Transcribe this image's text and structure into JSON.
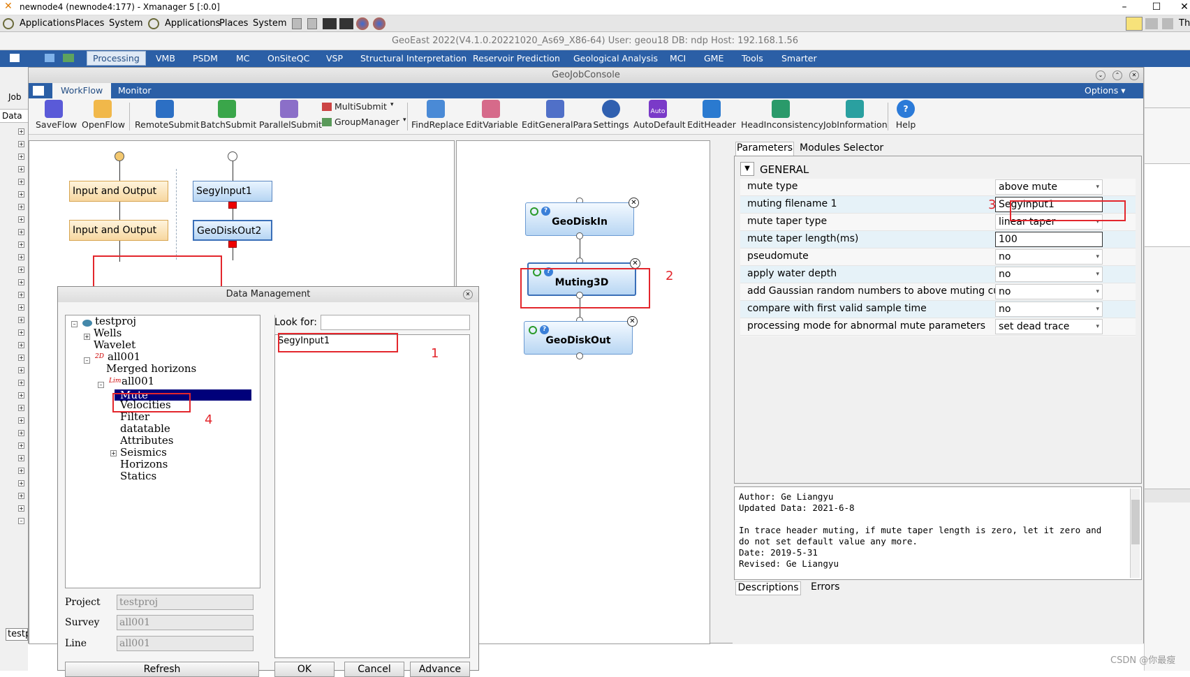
{
  "window": {
    "title": "newnode4 (newnode4:177) - Xmanager 5 [:0.0]"
  },
  "gnome": {
    "items": [
      "Applications",
      "Places",
      "System",
      "Applications",
      "Places",
      "System"
    ],
    "tray_right": "Th"
  },
  "system_info": "GeoEast 2022(V4.1.0.20221020_As69_X86-64)   User: geou18    DB: ndp    Host: 192.168.1.56",
  "menu": {
    "items": [
      "Processing",
      "VMB",
      "PSDM",
      "MC",
      "OnSiteQC",
      "VSP",
      "Structural Interpretation",
      "Reservoir Prediction",
      "Geological Analysis",
      "MCI",
      "GME",
      "Tools",
      "Smarter"
    ],
    "active": "Processing"
  },
  "side": {
    "job_label": "Job",
    "data_label": "Data"
  },
  "console": {
    "title": "GeoJobConsole",
    "tabs": [
      "WorkFlow",
      "Monitor"
    ],
    "options_label": "Options",
    "toolbar": [
      "SaveFlow",
      "OpenFlow",
      "RemoteSubmit",
      "BatchSubmit",
      "ParallelSubmit",
      "MultiSubmit",
      "GroupManager",
      "FindReplace",
      "EditVariable",
      "EditGeneralPara",
      "Settings",
      "AutoDefault",
      "EditHeader",
      "HeadInconsistency",
      "JobInformation",
      "Help"
    ],
    "auto_badge": "Auto"
  },
  "flow_left": {
    "nodes": [
      "Input and Output",
      "Input and Output",
      "SegyInput1",
      "GeoDiskOut2"
    ]
  },
  "flow_mid": {
    "nodes": [
      "GeoDiskIn",
      "Muting3D",
      "GeoDiskOut"
    ]
  },
  "params": {
    "tabs": [
      "Parameters",
      "Modules Selector"
    ],
    "section": "GENERAL",
    "rows": [
      {
        "label": "mute type",
        "value": "above mute"
      },
      {
        "label": "muting filename 1",
        "value": "SegyInput1"
      },
      {
        "label": "mute taper type",
        "value": "linear taper"
      },
      {
        "label": "mute taper length(ms)",
        "value": "100"
      },
      {
        "label": "pseudomute",
        "value": "no"
      },
      {
        "label": "apply water depth",
        "value": "no"
      },
      {
        "label": "add Gaussian random numbers to above muting curve",
        "value": "no"
      },
      {
        "label": "compare with first valid sample time",
        "value": "no"
      },
      {
        "label": "processing mode for abnormal mute parameters",
        "value": "set dead trace"
      }
    ],
    "description": "Author: Ge Liangyu\nUpdated Data: 2021-6-8\n\nIn trace header muting, if mute taper length is zero, let it zero and\ndo not set default value any more.\nDate: 2019-5-31\nRevised: Ge Liangyu",
    "bottom_tabs": [
      "Descriptions",
      "Errors"
    ]
  },
  "data_mgmt": {
    "title": "Data Management",
    "tree": [
      "testproj",
      "Wells",
      "Wavelet",
      "all001",
      "Merged horizons",
      "all001",
      "Mute",
      "Velocities",
      "Filter",
      "datatable",
      "Attributes",
      "Seismics",
      "Horizons",
      "Statics"
    ],
    "line_tag": "2D",
    "lim_tag": "Lim",
    "look_for_label": "Look for:",
    "look_for_value": "",
    "result": "SegyInput1",
    "project_label": "Project",
    "project_value": "testproj",
    "survey_label": "Survey",
    "survey_value": "all001",
    "line_label": "Line",
    "line_value": "all001",
    "buttons": [
      "Refresh",
      "OK",
      "Cancel",
      "Advance"
    ]
  },
  "annotations": [
    "1",
    "2",
    "3",
    "4"
  ],
  "left_panel_tab": "testp",
  "watermark": "CSDN @你最瘦"
}
